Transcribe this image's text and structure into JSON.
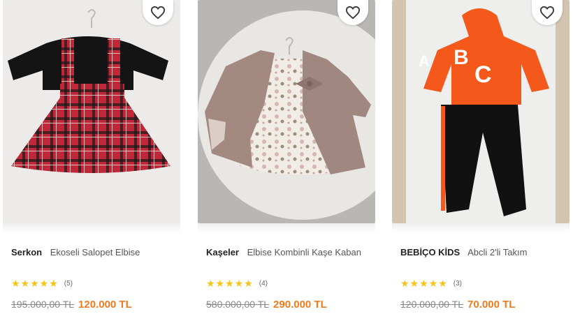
{
  "products": [
    {
      "brand": "Serkon",
      "name": "Ekoseli Salopet Elbise",
      "stars": "★★★★★",
      "review_count": "(5)",
      "old_price": "195.000,00 TL",
      "new_price": "120.000 TL",
      "image_icon": "plaid-pinafore-dress-image"
    },
    {
      "brand": "Kaşeler",
      "name": "Elbise Kombinli Kaşe Kaban",
      "stars": "★★★★★",
      "review_count": "(4)",
      "old_price": "580.000,00 TL",
      "new_price": "290.000 TL",
      "image_icon": "floral-dress-coat-image"
    },
    {
      "brand": "BEBİÇO KİDS",
      "name": "Abcli 2'li Takım",
      "stars": "★★★★★",
      "review_count": "(3)",
      "old_price": "120.000,00 TL",
      "new_price": "70.000 TL",
      "image_icon": "abc-hoodie-set-image"
    }
  ],
  "colors": {
    "accent_price": "#f27a1a",
    "star": "#f6c416"
  }
}
